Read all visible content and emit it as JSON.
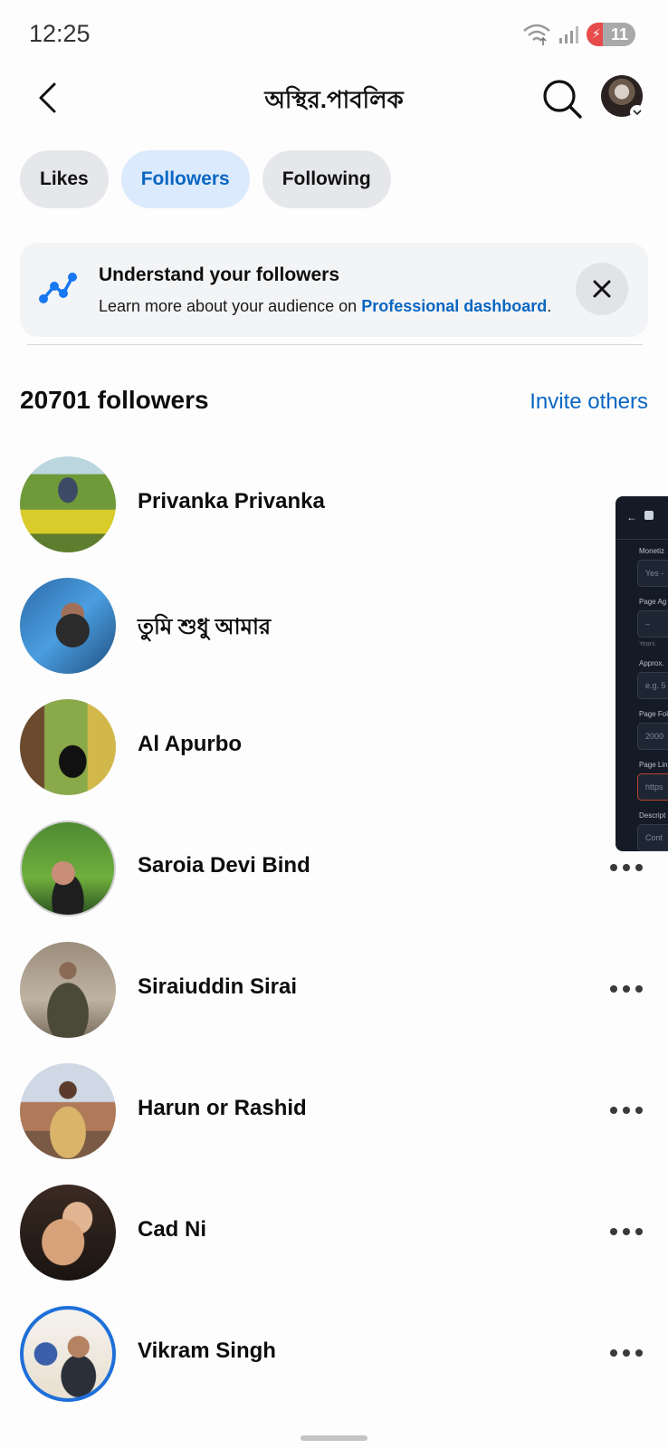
{
  "status_bar": {
    "time": "12:25",
    "battery": "11"
  },
  "header": {
    "title": "অস্থির.পাবলিক"
  },
  "tabs": [
    {
      "label": "Likes",
      "active": false
    },
    {
      "label": "Followers",
      "active": true
    },
    {
      "label": "Following",
      "active": false
    }
  ],
  "banner": {
    "title": "Understand your followers",
    "text_before": "Learn more about your audience on ",
    "link": "Professional dashboard",
    "text_after": "."
  },
  "followers": {
    "count_label": "20701 followers",
    "invite_label": "Invite others",
    "items": [
      {
        "name": "Privanka Privanka"
      },
      {
        "name": "তুমি শুধু আমার"
      },
      {
        "name": "Al Apurbo"
      },
      {
        "name": "Saroia Devi Bind"
      },
      {
        "name": "Siraiuddin Sirai"
      },
      {
        "name": "Harun or Rashid"
      },
      {
        "name": "Cad Ni"
      },
      {
        "name": "Vikram Singh"
      }
    ]
  },
  "overlay": {
    "labels": [
      "Monetiz",
      "Page Ag",
      "Years",
      "Approx.",
      "Page Fol",
      "Page Lin",
      "Descript"
    ],
    "fields": [
      "Yes -",
      "–",
      "e.g. 5",
      "2000",
      "https",
      "Cont"
    ]
  },
  "colors": {
    "accent": "#0a66c2",
    "active_tab_bg": "#dbeafc",
    "chip_bg": "#e6e7eb"
  }
}
